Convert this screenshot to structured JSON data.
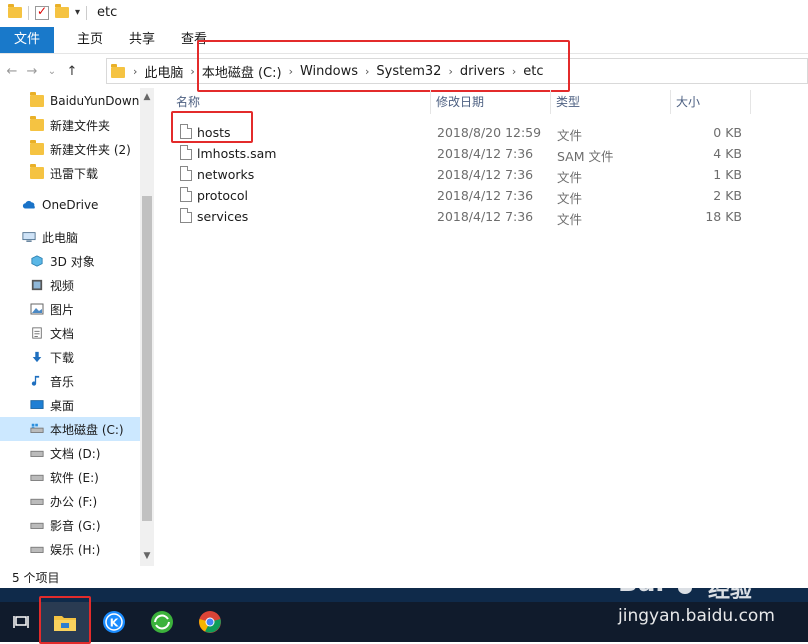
{
  "window": {
    "title": "etc"
  },
  "ribbon": {
    "tabs": [
      "文件",
      "主页",
      "共享",
      "查看"
    ]
  },
  "nav": {
    "back": "←",
    "forward": "→",
    "recent": "⌄",
    "up": "↑"
  },
  "address": {
    "crumbs": [
      "此电脑",
      "本地磁盘 (C:)",
      "Windows",
      "System32",
      "drivers",
      "etc"
    ]
  },
  "sidebar": {
    "items": [
      {
        "label": "BaiduYunDown",
        "icon": "folder-icon"
      },
      {
        "label": "新建文件夹",
        "icon": "folder-icon"
      },
      {
        "label": "新建文件夹 (2)",
        "icon": "folder-icon"
      },
      {
        "label": "迅雷下载",
        "icon": "folder-icon"
      },
      {
        "label": "OneDrive",
        "icon": "cloud-icon"
      },
      {
        "label": "此电脑",
        "icon": "computer-icon"
      },
      {
        "label": "3D 对象",
        "icon": "cube-icon"
      },
      {
        "label": "视频",
        "icon": "video-icon"
      },
      {
        "label": "图片",
        "icon": "picture-icon"
      },
      {
        "label": "文档",
        "icon": "document-icon"
      },
      {
        "label": "下载",
        "icon": "download-icon"
      },
      {
        "label": "音乐",
        "icon": "music-icon"
      },
      {
        "label": "桌面",
        "icon": "desktop-icon"
      },
      {
        "label": "本地磁盘 (C:)",
        "icon": "drive-icon"
      },
      {
        "label": "文档 (D:)",
        "icon": "drive-icon"
      },
      {
        "label": "软件 (E:)",
        "icon": "drive-icon"
      },
      {
        "label": "办公 (F:)",
        "icon": "drive-icon"
      },
      {
        "label": "影音 (G:)",
        "icon": "drive-icon"
      },
      {
        "label": "娱乐 (H:)",
        "icon": "drive-icon"
      }
    ]
  },
  "table": {
    "columns": [
      "名称",
      "修改日期",
      "类型",
      "大小"
    ],
    "rows": [
      {
        "name": "hosts",
        "date": "2018/8/20 12:59",
        "type": "文件",
        "size": "0 KB"
      },
      {
        "name": "lmhosts.sam",
        "date": "2018/4/12 7:36",
        "type": "SAM 文件",
        "size": "4 KB"
      },
      {
        "name": "networks",
        "date": "2018/4/12 7:36",
        "type": "文件",
        "size": "1 KB"
      },
      {
        "name": "protocol",
        "date": "2018/4/12 7:36",
        "type": "文件",
        "size": "2 KB"
      },
      {
        "name": "services",
        "date": "2018/4/12 7:36",
        "type": "文件",
        "size": "18 KB"
      }
    ]
  },
  "status": {
    "count": "5 个项目"
  },
  "watermark": {
    "brand": "Bai",
    "brand2": "经验",
    "url": "jingyan.baidu.com"
  },
  "colors": {
    "accent": "#1979ca",
    "highlight": "#e32b2b",
    "taskbar": "#101b2c"
  }
}
